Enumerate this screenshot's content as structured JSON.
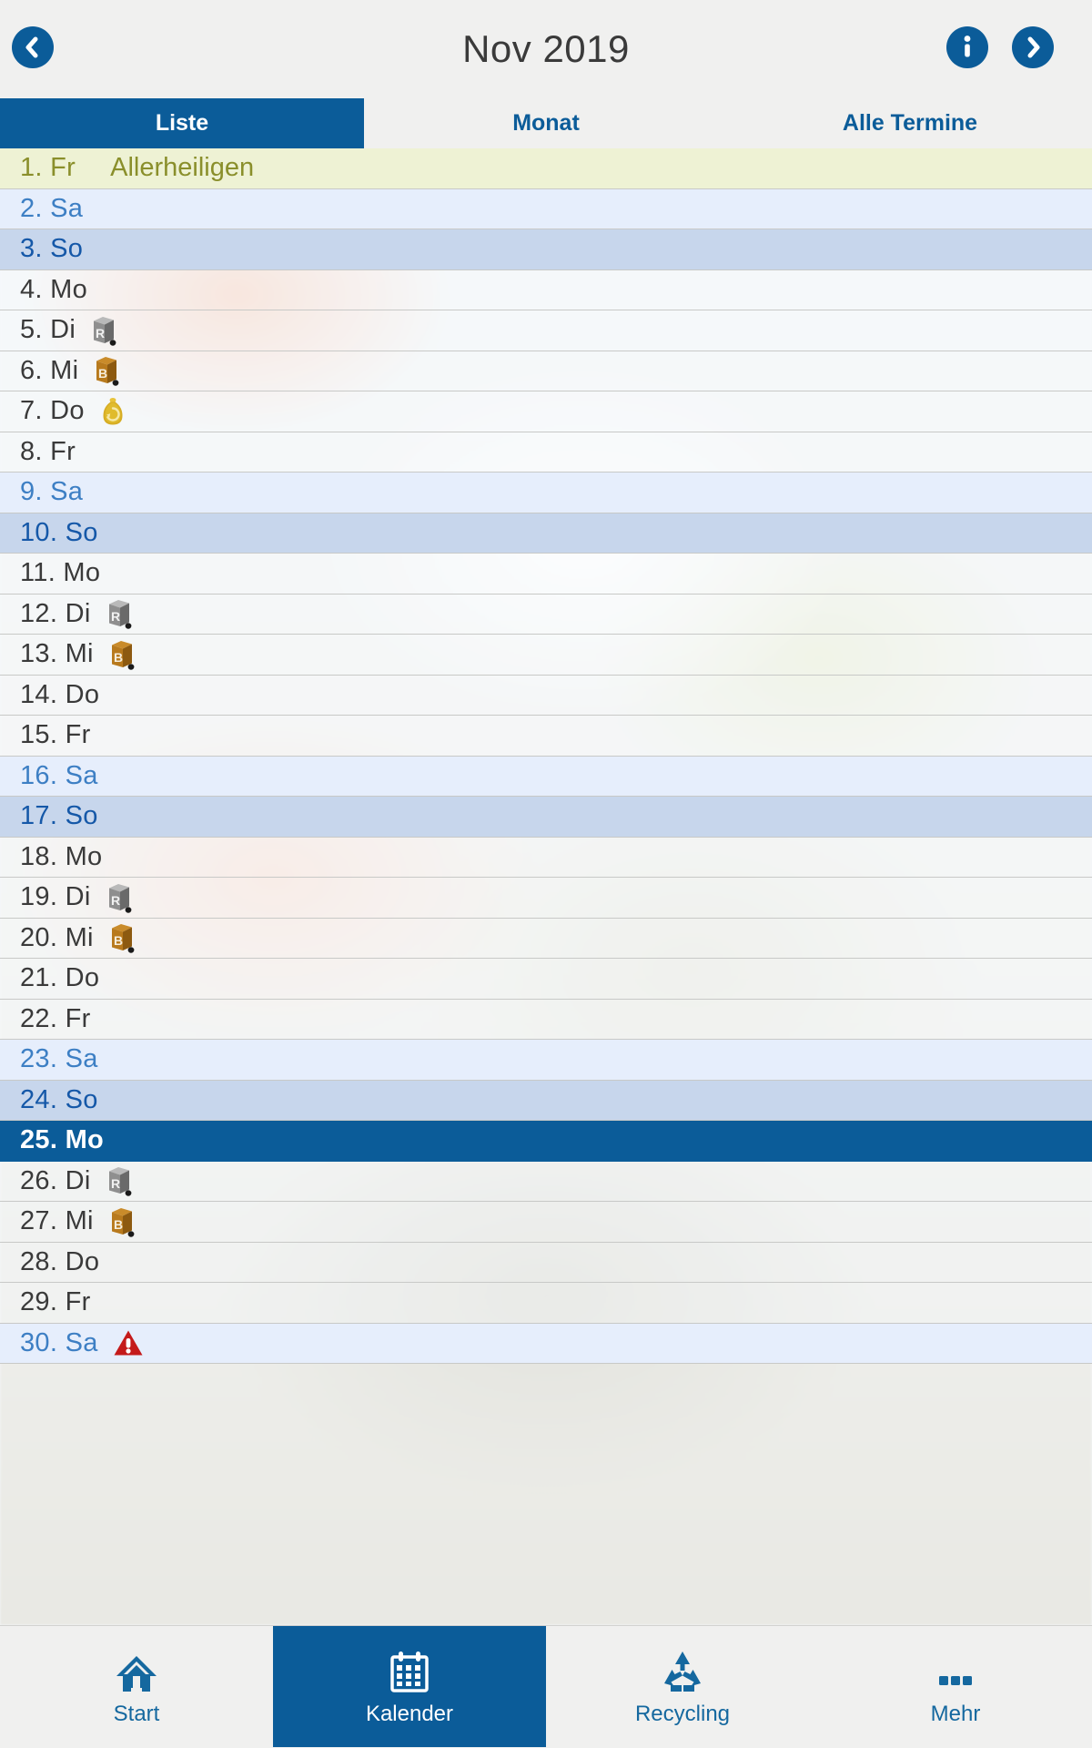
{
  "header": {
    "title": "Nov 2019",
    "back_icon": "chevron-left-circle-icon",
    "info_icon": "info-circle-icon",
    "forward_icon": "chevron-right-circle-icon"
  },
  "segments": [
    {
      "label": "Liste",
      "active": true
    },
    {
      "label": "Monat",
      "active": false
    },
    {
      "label": "Alle Termine",
      "active": false
    }
  ],
  "colors": {
    "accent": "#0b5c99",
    "saturday_bg": "#e6eefc",
    "sunday_bg": "#c7d6ec",
    "holiday_bg": "#eef2d4",
    "holiday_text": "#8a8f2b",
    "today_bg": "#0b5c99",
    "bin_residual": "#6d6d6d",
    "bin_bio": "#a7701f",
    "sack_yellow": "#d8b228",
    "warning_red": "#c41a1a"
  },
  "list": {
    "rows": [
      {
        "day": "1. Fr",
        "kind": "holiday",
        "event": "Allerheiligen",
        "icons": []
      },
      {
        "day": "2. Sa",
        "kind": "saturday",
        "event": "",
        "icons": []
      },
      {
        "day": "3. So",
        "kind": "sunday",
        "event": "",
        "icons": []
      },
      {
        "day": "4. Mo",
        "kind": "weekday",
        "event": "",
        "icons": []
      },
      {
        "day": "5. Di",
        "kind": "weekday",
        "event": "",
        "icons": [
          "bin-residual-icon"
        ]
      },
      {
        "day": "6. Mi",
        "kind": "weekday",
        "event": "",
        "icons": [
          "bin-bio-icon"
        ]
      },
      {
        "day": "7. Do",
        "kind": "weekday",
        "event": "",
        "icons": [
          "yellow-sack-icon"
        ]
      },
      {
        "day": "8. Fr",
        "kind": "weekday",
        "event": "",
        "icons": []
      },
      {
        "day": "9. Sa",
        "kind": "saturday",
        "event": "",
        "icons": []
      },
      {
        "day": "10. So",
        "kind": "sunday",
        "event": "",
        "icons": []
      },
      {
        "day": "11. Mo",
        "kind": "weekday",
        "event": "",
        "icons": []
      },
      {
        "day": "12. Di",
        "kind": "weekday",
        "event": "",
        "icons": [
          "bin-residual-icon"
        ]
      },
      {
        "day": "13. Mi",
        "kind": "weekday",
        "event": "",
        "icons": [
          "bin-bio-icon"
        ]
      },
      {
        "day": "14. Do",
        "kind": "weekday",
        "event": "",
        "icons": []
      },
      {
        "day": "15. Fr",
        "kind": "weekday",
        "event": "",
        "icons": []
      },
      {
        "day": "16. Sa",
        "kind": "saturday",
        "event": "",
        "icons": []
      },
      {
        "day": "17. So",
        "kind": "sunday",
        "event": "",
        "icons": []
      },
      {
        "day": "18. Mo",
        "kind": "weekday",
        "event": "",
        "icons": []
      },
      {
        "day": "19. Di",
        "kind": "weekday",
        "event": "",
        "icons": [
          "bin-residual-icon"
        ]
      },
      {
        "day": "20. Mi",
        "kind": "weekday",
        "event": "",
        "icons": [
          "bin-bio-icon"
        ]
      },
      {
        "day": "21. Do",
        "kind": "weekday",
        "event": "",
        "icons": []
      },
      {
        "day": "22. Fr",
        "kind": "weekday",
        "event": "",
        "icons": []
      },
      {
        "day": "23. Sa",
        "kind": "saturday",
        "event": "",
        "icons": []
      },
      {
        "day": "24. So",
        "kind": "sunday",
        "event": "",
        "icons": []
      },
      {
        "day": "25. Mo",
        "kind": "today",
        "event": "",
        "icons": []
      },
      {
        "day": "26. Di",
        "kind": "weekday",
        "event": "",
        "icons": [
          "bin-residual-icon"
        ]
      },
      {
        "day": "27. Mi",
        "kind": "weekday",
        "event": "",
        "icons": [
          "bin-bio-icon"
        ]
      },
      {
        "day": "28. Do",
        "kind": "weekday",
        "event": "",
        "icons": []
      },
      {
        "day": "29. Fr",
        "kind": "weekday",
        "event": "",
        "icons": []
      },
      {
        "day": "30. Sa",
        "kind": "saturday",
        "event": "",
        "icons": [
          "warning-icon"
        ]
      }
    ]
  },
  "tabbar": {
    "items": [
      {
        "label": "Start",
        "icon": "home-icon",
        "active": false
      },
      {
        "label": "Kalender",
        "icon": "calendar-icon",
        "active": true
      },
      {
        "label": "Recycling",
        "icon": "recycling-icon",
        "active": false
      },
      {
        "label": "Mehr",
        "icon": "more-dots-icon",
        "active": false
      }
    ]
  }
}
